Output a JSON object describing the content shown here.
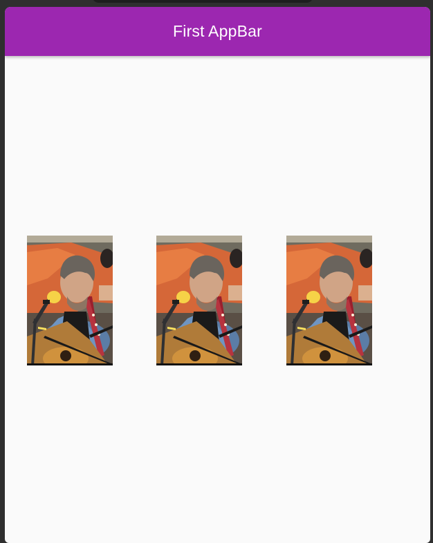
{
  "window": {
    "background": "#2f2f2f"
  },
  "appbar": {
    "title": "First AppBar",
    "color": "#9c27b0",
    "title_color": "#ffffff"
  },
  "content": {
    "background": "#fafafa",
    "images": [
      {
        "alt": "musician-photo"
      },
      {
        "alt": "musician-photo"
      },
      {
        "alt": "musician-photo"
      }
    ]
  }
}
